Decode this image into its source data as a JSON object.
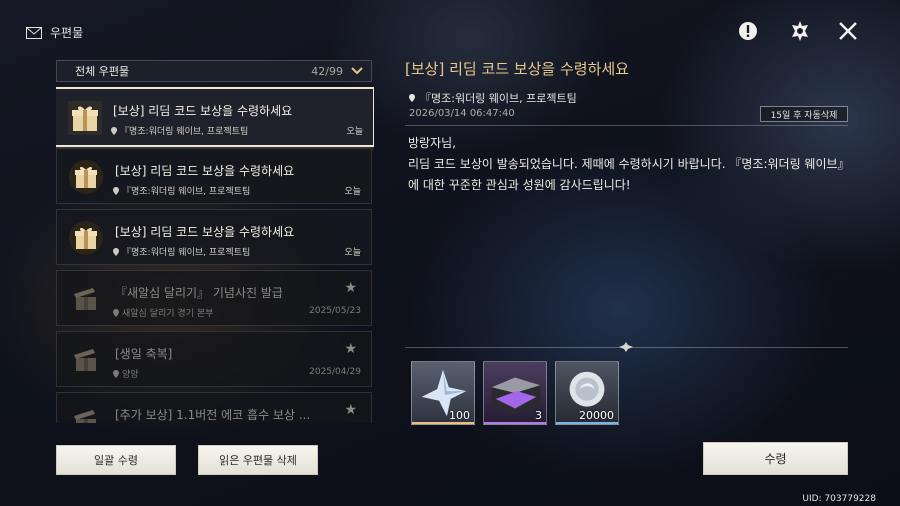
{
  "header": {
    "title": "우편물"
  },
  "filter": {
    "label": "전체 우편물",
    "count": "42/99"
  },
  "mails": [
    {
      "subject": "[보상] 리딤 코드 보상을 수령하세요",
      "sender": "『명조:워더링 웨이브, 프로젝트팀",
      "date": "오늘"
    },
    {
      "subject": "[보상] 리딤 코드 보상을 수령하세요",
      "sender": "『명조:워더링 웨이브, 프로젝트팀",
      "date": "오늘"
    },
    {
      "subject": "[보상] 리딤 코드 보상을 수령하세요",
      "sender": "『명조:워더링 웨이브, 프로젝트팀",
      "date": "오늘"
    },
    {
      "subject": "『새알심 달리기』 기념사진 발급",
      "sender": "새알심 달리기 경기 본부",
      "date": "2025/05/23"
    },
    {
      "subject": "[생일 축복]",
      "sender": "양양",
      "date": "2025/04/29"
    },
    {
      "subject": "[추가 보상] 1.1버전 에코 흡수 보상 ...",
      "sender": "",
      "date": ""
    }
  ],
  "buttons": {
    "claim_all": "일괄 수령",
    "delete_read": "읽은 우편물 삭제",
    "claim": "수령"
  },
  "detail": {
    "title": "[보상] 리딤 코드 보상을 수령하세요",
    "sender": "『명조:워더링 웨이브, 프로젝트팀",
    "timestamp": "2026/03/14 06:47:40",
    "expire": "15일 후 자동삭제",
    "greeting": "방랑자님,",
    "body": "리딤 코드 보상이 발송되었습니다. 제때에 수령하시기 바랍니다. 『명조:워더링 웨이브』에 대한 꾸준한 관심과 성원에 감사드립니다!"
  },
  "rewards": [
    {
      "icon": "astrite-crystal-icon",
      "quantity": "100",
      "rarity_color": "#e6c27a"
    },
    {
      "icon": "purple-resource-box-icon",
      "quantity": "3",
      "rarity_color": "#b07ae0"
    },
    {
      "icon": "shell-credit-coin-icon",
      "quantity": "20000",
      "rarity_color": "#7ab4e0"
    }
  ],
  "footer": {
    "uid": "UID: 703779228"
  },
  "colors": {
    "accent_title": "#e7c98d",
    "selected_border": "#efe7d2"
  }
}
